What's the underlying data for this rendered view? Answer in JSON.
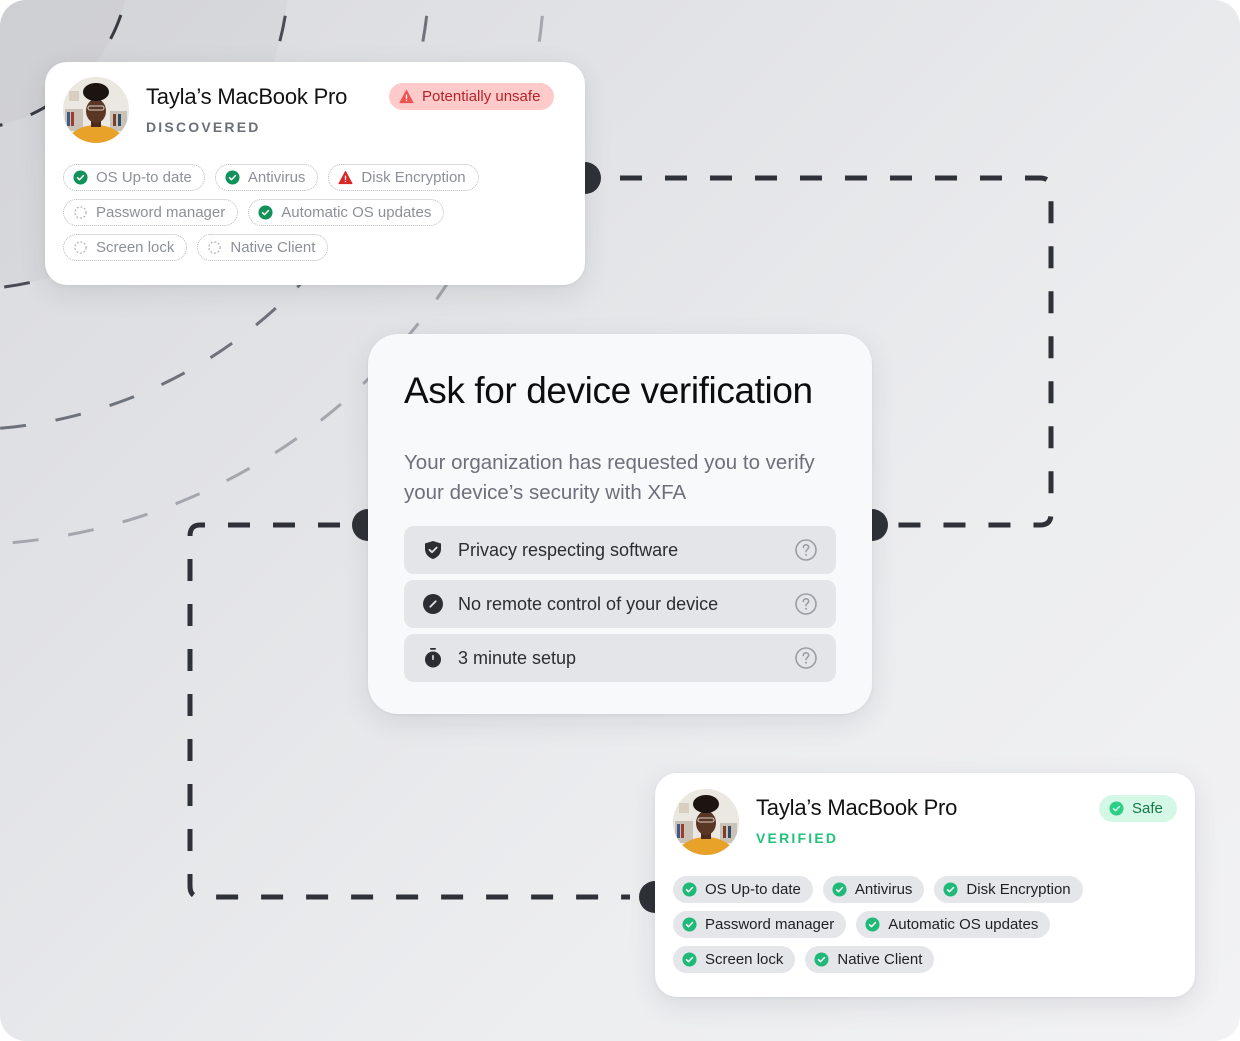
{
  "colors": {
    "connector": "#2e3138",
    "success": "#1fb978",
    "success_dark": "#12915a",
    "danger": "#dc2626",
    "unsafe_bg": "#fecaca",
    "safe_bg": "#d4f7e6"
  },
  "discovered_device": {
    "name": "Tayla’s MacBook Pro",
    "state": "DISCOVERED",
    "status_badge": {
      "label": "Potentially unsafe",
      "icon": "warning-triangle-icon"
    },
    "checks": [
      {
        "label": "OS Up-to date",
        "status": "passed",
        "icon": "check-circle-icon"
      },
      {
        "label": "Antivirus",
        "status": "passed",
        "icon": "check-circle-icon"
      },
      {
        "label": "Disk Encryption",
        "status": "failed",
        "icon": "warning-triangle-icon"
      },
      {
        "label": "Password manager",
        "status": "unknown",
        "icon": "dashed-circle-icon"
      },
      {
        "label": "Automatic OS updates",
        "status": "passed",
        "icon": "check-circle-icon"
      },
      {
        "label": "Screen lock",
        "status": "unknown",
        "icon": "dashed-circle-icon"
      },
      {
        "label": "Native Client",
        "status": "unknown",
        "icon": "dashed-circle-icon"
      }
    ]
  },
  "verification_prompt": {
    "title": "Ask for device verification",
    "description": "Your organization has requested you to verify your device’s security with XFA",
    "features": [
      {
        "label": "Privacy respecting software",
        "icon": "shield-check-icon",
        "help_icon": "question-circle-icon"
      },
      {
        "label": "No remote control of your device",
        "icon": "slash-circle-icon",
        "help_icon": "question-circle-icon"
      },
      {
        "label": "3 minute setup",
        "icon": "stopwatch-icon",
        "help_icon": "question-circle-icon"
      }
    ]
  },
  "verified_device": {
    "name": "Tayla’s MacBook Pro",
    "state": "VERIFIED",
    "status_badge": {
      "label": "Safe",
      "icon": "check-circle-icon"
    },
    "checks": [
      {
        "label": "OS Up-to date",
        "status": "passed",
        "icon": "check-circle-icon"
      },
      {
        "label": "Antivirus",
        "status": "passed",
        "icon": "check-circle-icon"
      },
      {
        "label": "Disk Encryption",
        "status": "passed",
        "icon": "check-circle-icon"
      },
      {
        "label": "Password manager",
        "status": "passed",
        "icon": "check-circle-icon"
      },
      {
        "label": "Automatic OS updates",
        "status": "passed",
        "icon": "check-circle-icon"
      },
      {
        "label": "Screen lock",
        "status": "passed",
        "icon": "check-circle-icon"
      },
      {
        "label": "Native Client",
        "status": "passed",
        "icon": "check-circle-icon"
      }
    ]
  }
}
